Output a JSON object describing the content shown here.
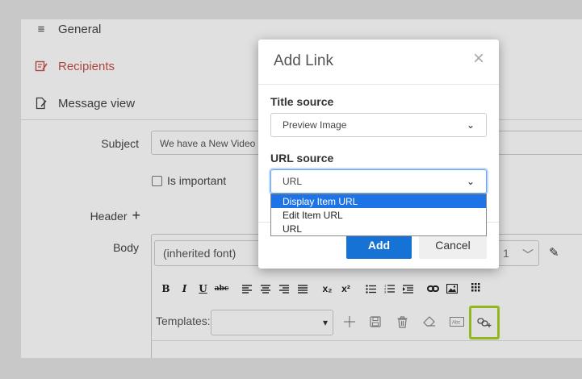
{
  "nav": {
    "general": "General",
    "recipients": "Recipients",
    "message_view": "Message view"
  },
  "form": {
    "subject_label": "Subject",
    "subject_value": "We have a New Video c",
    "important_label": "Is important",
    "header_label": "Header",
    "body_label": "Body",
    "font_value": "(inherited font)",
    "size_value": "1",
    "templates_label": "Templates:"
  },
  "toolbar": {
    "bold": "B",
    "italic": "I",
    "underline": "U",
    "strike": "abc",
    "subscript": "x₂",
    "superscript": "x²"
  },
  "modal": {
    "title": "Add Link",
    "title_source_label": "Title source",
    "title_source_value": "Preview Image",
    "url_source_label": "URL source",
    "url_source_value": "URL",
    "url_options": [
      "Display Item URL",
      "Edit Item URL",
      "URL"
    ],
    "add_label": "Add",
    "cancel_label": "Cancel"
  },
  "colors": {
    "accent": "#1672d5",
    "highlight": "#a6d322",
    "recipients": "#c8504a"
  }
}
